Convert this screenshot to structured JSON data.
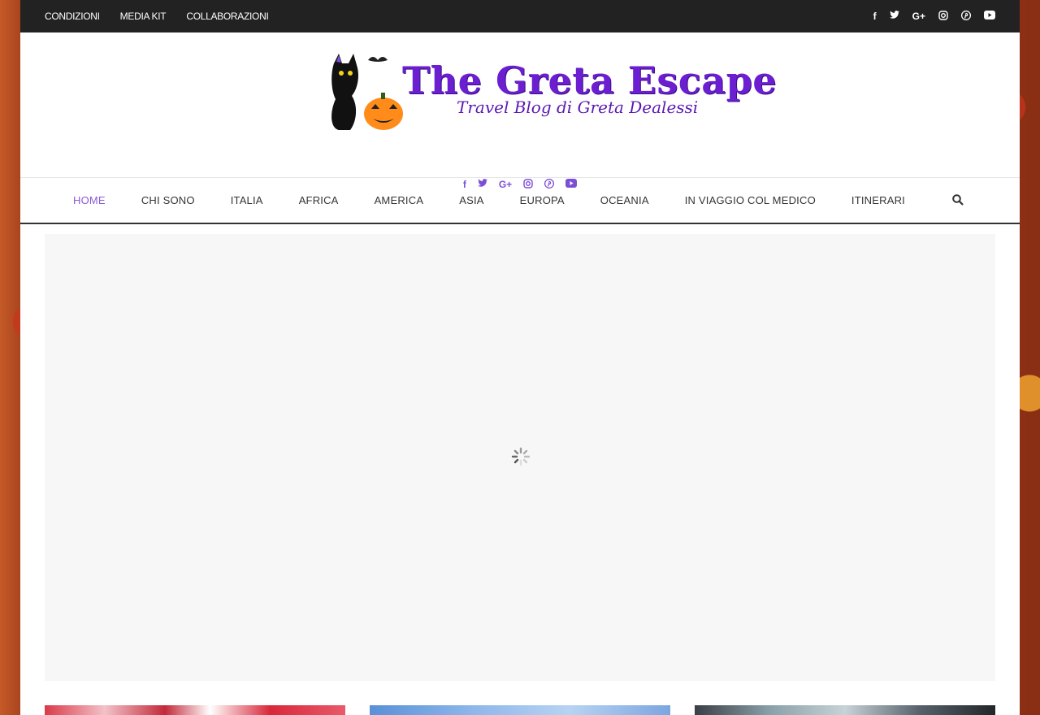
{
  "topbar": {
    "links": [
      "CONDIZIONI",
      "MEDIA KIT",
      "COLLABORAZIONI"
    ],
    "social_icons": [
      "facebook-icon",
      "twitter-icon",
      "google-plus-icon",
      "instagram-icon",
      "pinterest-icon",
      "youtube-icon"
    ]
  },
  "logo": {
    "title": "The Greta Escape",
    "subtitle": "Travel Blog di Greta Dealessi"
  },
  "nav": {
    "items": [
      "HOME",
      "CHI SONO",
      "ITALIA",
      "AFRICA",
      "AMERICA",
      "ASIA",
      "EUROPA",
      "OCEANIA",
      "IN VIAGGIO COL MEDICO",
      "ITINERARI"
    ],
    "active": "HOME"
  },
  "colors": {
    "accent": "#8a5ad6",
    "brand": "#6b1fd1",
    "topbar": "#222222"
  }
}
